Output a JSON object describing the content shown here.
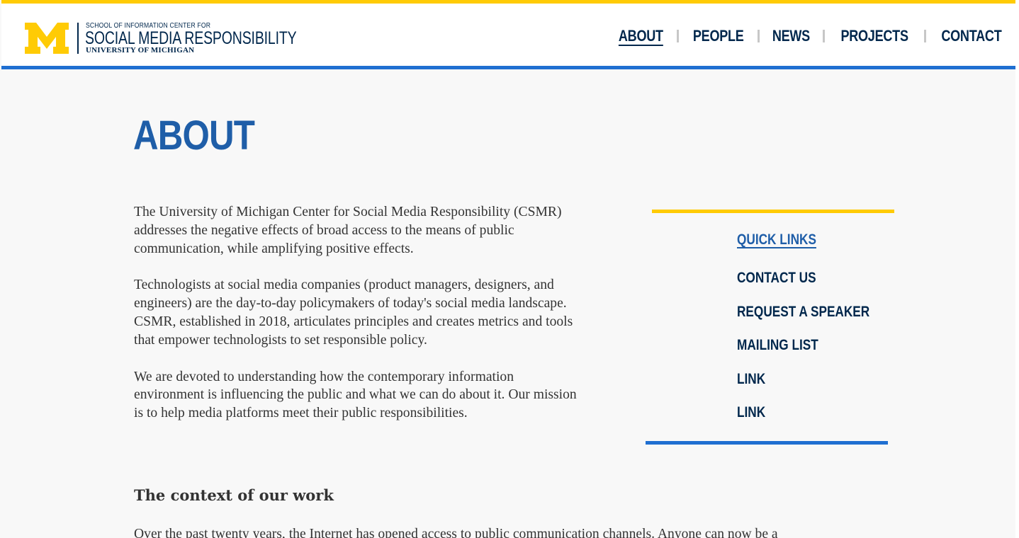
{
  "colors": {
    "maize": "#ffcb05",
    "blue": "#00274c",
    "accent_blue": "#1f6fd1",
    "title_blue": "#1f5ea8",
    "text": "#333333"
  },
  "logo": {
    "line1": "SCHOOL OF INFORMATION CENTER FOR",
    "line2": "SOCIAL MEDIA RESPONSIBILITY",
    "line3": "UNIVERSITY OF MICHIGAN"
  },
  "nav": {
    "items": [
      {
        "label": "ABOUT",
        "active": true
      },
      {
        "label": "PEOPLE",
        "active": false
      },
      {
        "label": "NEWS",
        "active": false
      },
      {
        "label": "PROJECTS",
        "active": false
      },
      {
        "label": "CONTACT",
        "active": false
      }
    ]
  },
  "main": {
    "title": "ABOUT",
    "paragraphs": [
      "The University of Michigan Center for Social Media Responsibility (CSMR) addresses the negative effects of broad access to the means of public communication, while amplifying positive effects.",
      "Technologists at social media companies (product managers, designers, and engineers) are the day-to-day policymakers of today's social media landscape. CSMR, established in 2018, articulates principles and creates metrics and tools that empower technologists to set responsible policy.",
      "We are devoted to understanding how the contemporary information environment is influencing the public and what we can do about it. Our mission is to help media platforms meet their public responsibilities."
    ],
    "section_heading": "The context of our work",
    "section_text": "Over the past twenty years, the Internet has opened access to public communication channels. Anyone can now be a"
  },
  "quick_links": {
    "title": "QUICK LINKS",
    "items": [
      "CONTACT US",
      "REQUEST A SPEAKER",
      "MAILING LIST",
      "LINK",
      "LINK"
    ]
  }
}
